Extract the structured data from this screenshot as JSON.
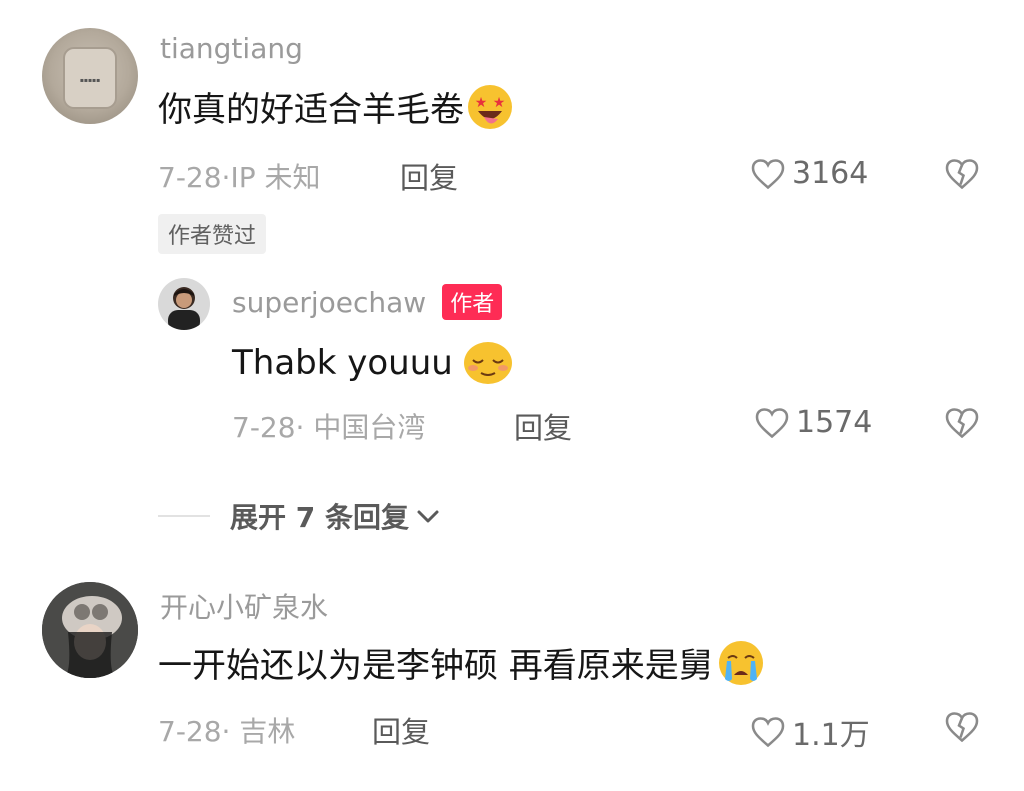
{
  "comments": [
    {
      "username": "tiangtiang",
      "content": "你真的好适合羊毛卷",
      "meta": "7-28·IP 未知",
      "reply_label": "回复",
      "likes": "3164",
      "badge": "作者赞过",
      "emoji": "star-eyes-tongue-emoji"
    },
    {
      "username": "superjoechaw",
      "author_tag": "作者",
      "content": "Thabk youuu",
      "meta": "7-28· 中国台湾",
      "reply_label": "回复",
      "likes": "1574",
      "emoji": "relieved-face-emoji"
    },
    {
      "username": "开心小矿泉水",
      "content": "一开始还以为是李钟硕 再看原来是舅",
      "meta": "7-28· 吉林",
      "reply_label": "回复",
      "likes": "1.1万",
      "emoji": "crying-face-emoji"
    }
  ],
  "expand_replies": "展开 7 条回复",
  "colors": {
    "accent": "#fe2c55",
    "secondary_text": "#a8a8a8",
    "emoji": "#f7c22f"
  }
}
